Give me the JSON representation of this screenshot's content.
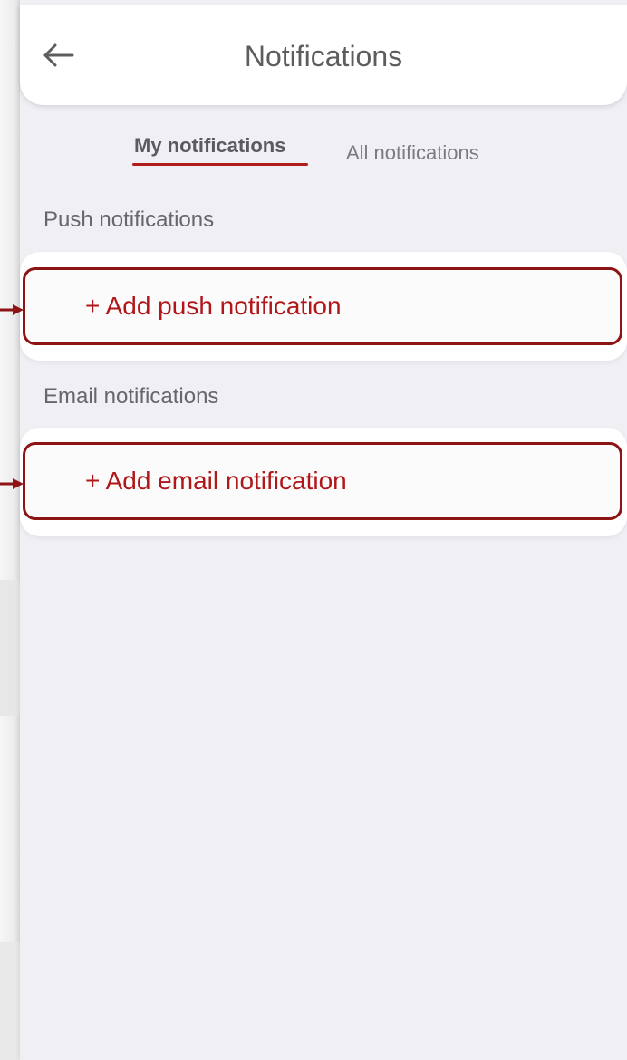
{
  "header": {
    "title": "Notifications",
    "back_icon": "arrow-left-icon"
  },
  "tabs": [
    {
      "label": "My notifications",
      "active": true
    },
    {
      "label": "All notifications",
      "active": false
    }
  ],
  "sections": {
    "push": {
      "label": "Push notifications",
      "add_label": "+ Add push notification"
    },
    "email": {
      "label": "Email notifications",
      "add_label": "+ Add email notification"
    }
  },
  "colors": {
    "accent": "#b0171a",
    "highlight_border": "#8c1414",
    "background": "#efeff4"
  }
}
